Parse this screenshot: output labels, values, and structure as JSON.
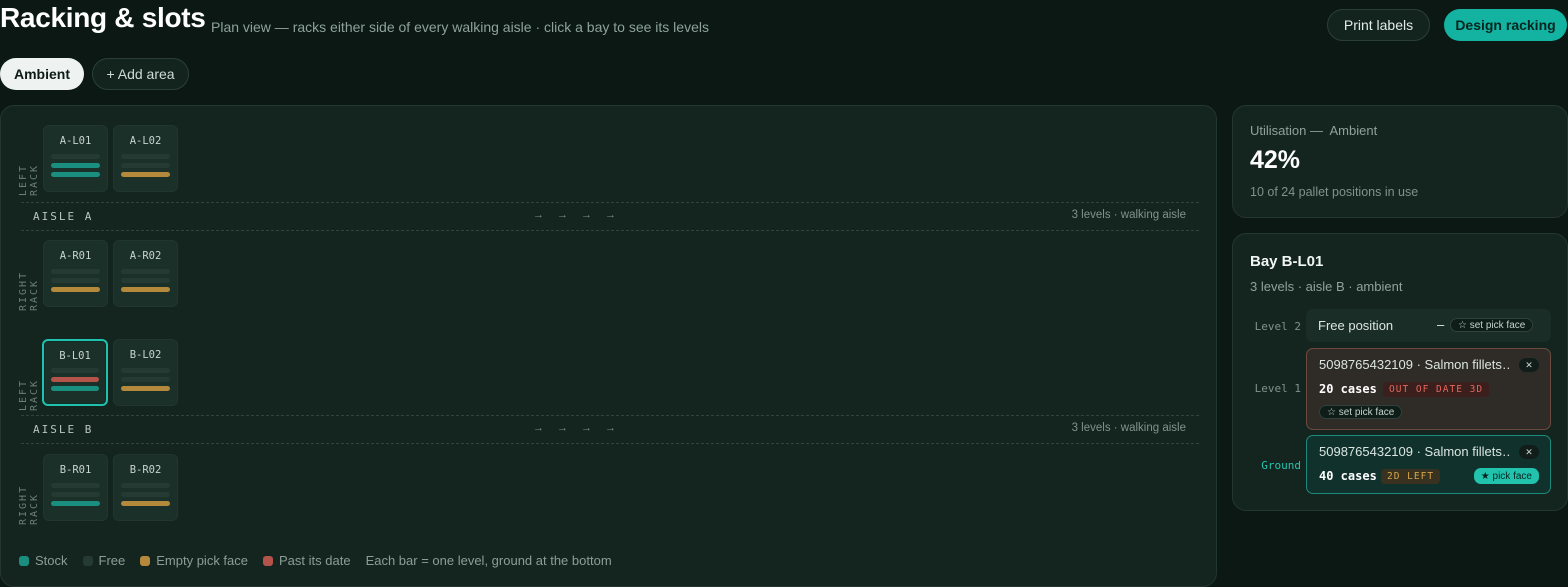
{
  "header": {
    "title": "Racking & slots",
    "subtitle": "Plan view — racks either side of every walking aisle · click a bay to see its levels",
    "print_label": "Print labels",
    "design_label": "Design racking"
  },
  "areas": {
    "active": "Ambient",
    "add_label": "+ Add area"
  },
  "plan": {
    "rack_left_label": "LEFT RACK",
    "rack_right_label": "RIGHT RACK",
    "aisle_a": {
      "name": "AISLE A",
      "arrows": "→→→→",
      "note": "3 levels · walking aisle"
    },
    "aisle_b": {
      "name": "AISLE B",
      "arrows": "→→→→",
      "note": "3 levels · walking aisle"
    },
    "bays": {
      "a_l01": {
        "id": "A-L01",
        "levels": [
          "stock",
          "stock",
          "free"
        ]
      },
      "a_l02": {
        "id": "A-L02",
        "levels": [
          "empty",
          "free",
          "free"
        ]
      },
      "a_r01": {
        "id": "A-R01",
        "levels": [
          "empty",
          "free",
          "free"
        ]
      },
      "a_r02": {
        "id": "A-R02",
        "levels": [
          "empty",
          "free",
          "free"
        ]
      },
      "b_l01": {
        "id": "B-L01",
        "levels": [
          "stock",
          "past",
          "free"
        ],
        "selected": true
      },
      "b_l02": {
        "id": "B-L02",
        "levels": [
          "empty",
          "free",
          "free"
        ]
      },
      "b_r01": {
        "id": "B-R01",
        "levels": [
          "stock",
          "free",
          "free"
        ]
      },
      "b_r02": {
        "id": "B-R02",
        "levels": [
          "empty",
          "free",
          "free"
        ]
      }
    }
  },
  "legend": {
    "stock": "Stock",
    "free": "Free",
    "empty": "Empty pick face",
    "past": "Past its date",
    "note": "Each bar = one level, ground at the bottom"
  },
  "colors": {
    "stock": "#1a8f80",
    "free": "#263a34",
    "empty": "#b4893b",
    "past": "#b3534a",
    "accent": "#14b2a0"
  },
  "utilisation": {
    "label": "Utilisation —",
    "area": "Ambient",
    "percent": "42%",
    "detail": "10 of 24 pallet positions in use"
  },
  "bay_detail": {
    "title": "Bay B-L01",
    "subtitle": "3 levels · aisle B · ambient",
    "level2": {
      "label": "Level 2",
      "text": "Free position",
      "dash": "–",
      "pick_action": "☆ set pick face"
    },
    "level1": {
      "label": "Level 1",
      "product": "5098765432109 · Salmon fillets…",
      "cases": "20 cases",
      "badge": "OUT OF DATE 3D",
      "pick_action": "☆ set pick face",
      "remove": "✕"
    },
    "ground": {
      "label": "Ground",
      "product": "5098765432109 · Salmon fillets…",
      "cases": "40 cases",
      "badge": "2D LEFT",
      "pick_state": "★ pick face",
      "remove": "✕"
    }
  }
}
